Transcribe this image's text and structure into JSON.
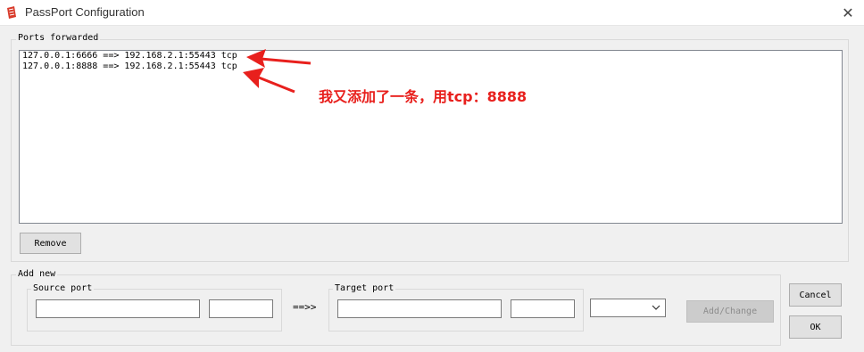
{
  "window": {
    "title": "PassPort Configuration",
    "icon": "passport-app-icon",
    "close_icon": "close-icon"
  },
  "ports_forwarded": {
    "label": "Ports forwarded",
    "items": [
      {
        "text": "127.0.0.1:6666 ==> 192.168.2.1:55443 tcp"
      },
      {
        "text": "127.0.0.1:8888 ==> 192.168.2.1:55443 tcp"
      }
    ],
    "remove_label": "Remove"
  },
  "add_new": {
    "label": "Add new",
    "source_port_label": "Source port",
    "source_address_value": "",
    "source_port_value": "",
    "arrow": "==>>",
    "target_port_label": "Target port",
    "target_address_value": "",
    "target_port_value": "",
    "protocol_value": "",
    "add_change_label": "Add/Change"
  },
  "dialog_buttons": {
    "cancel_label": "Cancel",
    "ok_label": "OK"
  },
  "annotation": {
    "text": "我又添加了一条，用tcp：8888",
    "color": "#e8201d"
  }
}
